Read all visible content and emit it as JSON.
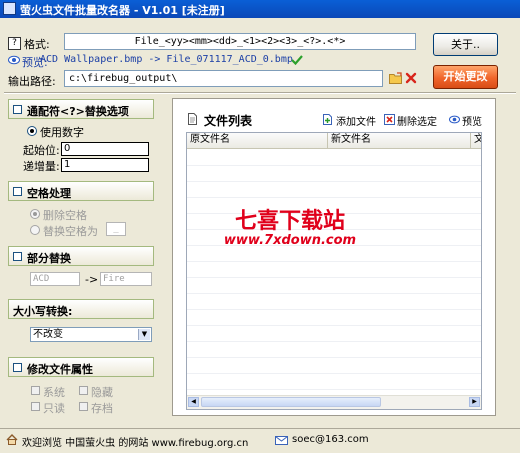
{
  "window": {
    "title": "萤火虫文件批量改名器 - V1.01  [未注册]"
  },
  "top": {
    "help_glyph": "?",
    "format_label": "格式:",
    "format_value": "File_<yy><mm><dd>_<1><2><3>_<?>.<*>",
    "preview_label": "预览:",
    "preview_text": "ACD Wallpaper.bmp -> File_071117_ACD_0.bmp",
    "output_label": "输出路径:",
    "output_value": "c:\\firebug_output\\",
    "about_button": "关于..",
    "start_button": "开始更改"
  },
  "wildcard": {
    "title": "通配符<?>替换选项",
    "use_number": "使用数字",
    "start_label": "起始位:",
    "start_value": "0",
    "increment_label": "递增量:",
    "increment_value": "1"
  },
  "space": {
    "title": "空格处理",
    "delete_space": "删除空格",
    "replace_space": "替换空格为",
    "replace_value": "_"
  },
  "partial": {
    "title": "部分替换",
    "from_value": "ACD",
    "arrow": "->",
    "to_value": "Fire"
  },
  "case": {
    "title": "大小写转换:",
    "selected": "不改变"
  },
  "attributes": {
    "title": "修改文件属性",
    "system": "系统",
    "hidden": "隐藏",
    "readonly": "只读",
    "archive": "存档"
  },
  "filelist": {
    "title": "文件列表",
    "add": "添加文件",
    "remove": "删除选定",
    "preview": "预览",
    "columns": [
      "原文件名",
      "新文件名",
      "文件"
    ]
  },
  "watermark": {
    "line1": "七喜下载站",
    "line2": "www.7xdown.com"
  },
  "status": {
    "welcome": "欢迎浏览 中国萤火虫 的网站 www.firebug.org.cn",
    "email": "soec@163.com"
  },
  "colors": {
    "start_button": "#f0652b",
    "preview_text": "#1b3fa6",
    "titlebar": "#0a5fd6"
  }
}
